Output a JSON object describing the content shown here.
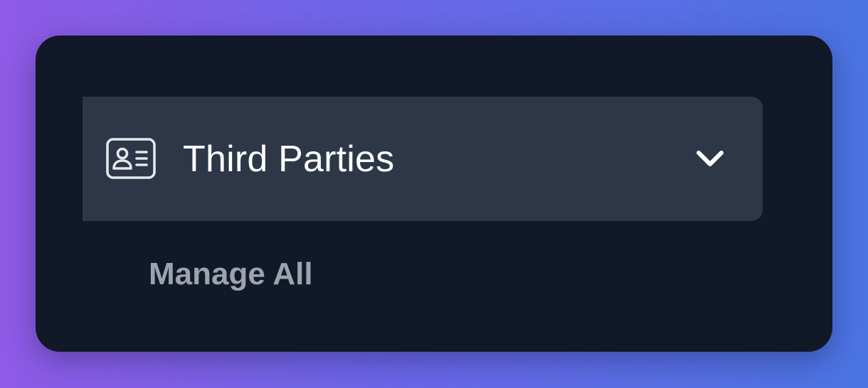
{
  "nav": {
    "section": {
      "label": "Third Parties",
      "icon": "id-card-icon",
      "expanded": true,
      "toggle_icon": "chevron-down-icon"
    },
    "sub_items": [
      {
        "label": "Manage All"
      }
    ]
  },
  "colors": {
    "panel_background": "#111827",
    "item_background": "#2d3748",
    "label_text": "#ffffff",
    "sub_item_text": "#9ca3af"
  }
}
